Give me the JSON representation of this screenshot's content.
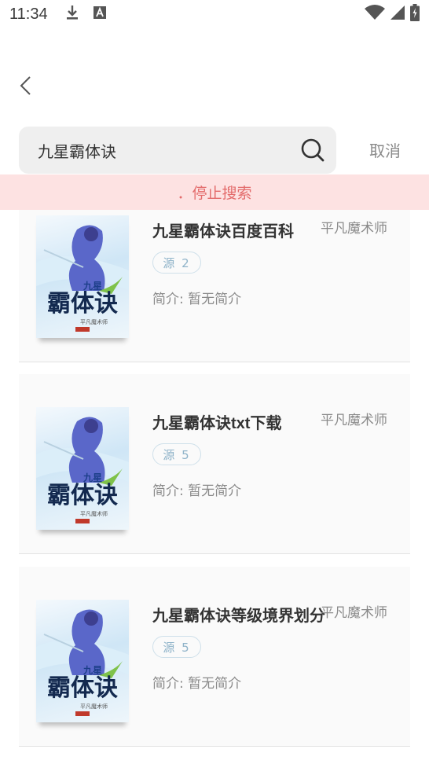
{
  "status": {
    "time": "11:34"
  },
  "search": {
    "query": "九星霸体诀",
    "cancel_label": "取消"
  },
  "stop_search_label": "．停止搜索",
  "results": [
    {
      "title": "九星霸体诀百度百科",
      "author": "平凡魔术师",
      "source": "源 2",
      "intro": "简介: 暂无简介",
      "cover": {
        "title_main": "霸体诀",
        "title_top": "九星",
        "author": "平凡魔术师"
      }
    },
    {
      "title": "九星霸体诀txt下载",
      "author": "平凡魔术师",
      "source": "源 5",
      "intro": "简介: 暂无简介",
      "cover": {
        "title_main": "霸体诀",
        "title_top": "九星",
        "author": "平凡魔术师"
      }
    },
    {
      "title": "九星霸体诀等级境界划分",
      "author": "平凡魔术师",
      "source": "源 5",
      "intro": "简介: 暂无简介",
      "cover": {
        "title_main": "霸体诀",
        "title_top": "九星",
        "author": "平凡魔术师"
      }
    }
  ]
}
